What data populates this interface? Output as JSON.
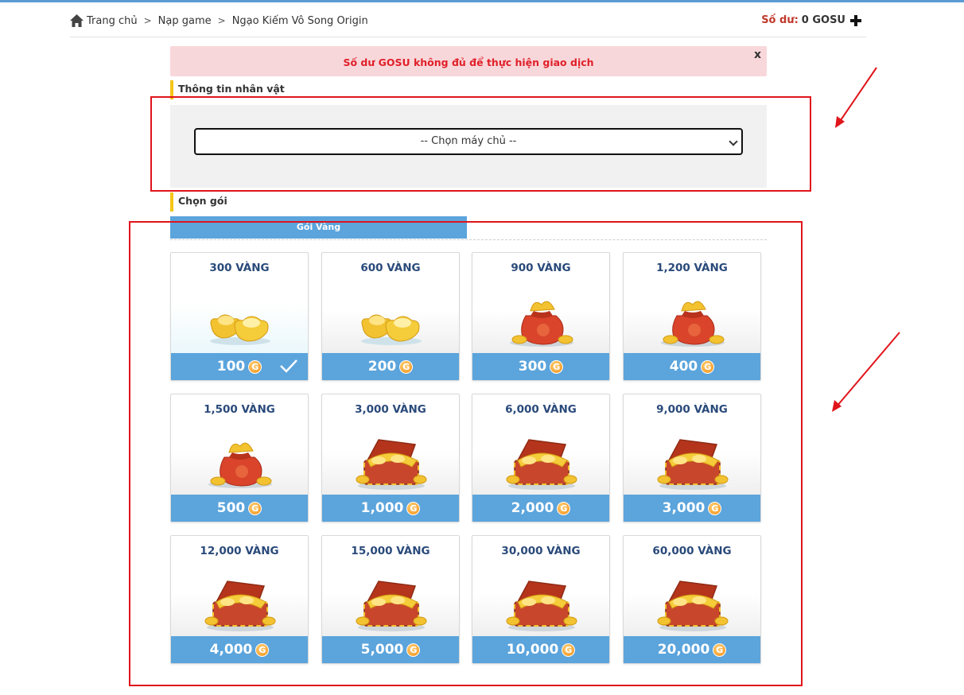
{
  "breadcrumb": {
    "home": "Trang chủ",
    "level2": "Nạp game",
    "level3": "Ngạo Kiếm Vô Song Origin"
  },
  "balance": {
    "label": "Số dư:",
    "value": "0 GOSU"
  },
  "alert": {
    "message": "Số dư GOSU không đủ để thực hiện giao dịch",
    "close": "x"
  },
  "sections": {
    "character": "Thông tin nhân vật",
    "package": "Chọn gói"
  },
  "server_select": {
    "selected": "-- Chọn máy chủ --"
  },
  "tabs": {
    "gold": "Gói Vàng"
  },
  "currency_icon": "G",
  "packages": [
    {
      "name": "300 VÀNG",
      "price": "100",
      "image": "gold-ingot",
      "selected": true
    },
    {
      "name": "600 VÀNG",
      "price": "200",
      "image": "gold-ingot"
    },
    {
      "name": "900 VÀNG",
      "price": "300",
      "image": "money-bag"
    },
    {
      "name": "1,200 VÀNG",
      "price": "400",
      "image": "money-bag"
    },
    {
      "name": "1,500 VÀNG",
      "price": "500",
      "image": "money-bag"
    },
    {
      "name": "3,000 VÀNG",
      "price": "1,000",
      "image": "treasure-chest"
    },
    {
      "name": "6,000 VÀNG",
      "price": "2,000",
      "image": "treasure-chest"
    },
    {
      "name": "9,000 VÀNG",
      "price": "3,000",
      "image": "treasure-chest"
    },
    {
      "name": "12,000 VÀNG",
      "price": "4,000",
      "image": "treasure-chest"
    },
    {
      "name": "15,000 VÀNG",
      "price": "5,000",
      "image": "treasure-chest"
    },
    {
      "name": "30,000 VÀNG",
      "price": "10,000",
      "image": "treasure-chest"
    },
    {
      "name": "60,000 VÀNG",
      "price": "20,000",
      "image": "treasure-chest"
    }
  ],
  "colors": {
    "accent_blue": "#5ba4dc",
    "annotation_red": "#e0141b",
    "alert_bg": "#f8d7da",
    "alert_text": "#e0202a",
    "section_marker": "#f5c518"
  }
}
